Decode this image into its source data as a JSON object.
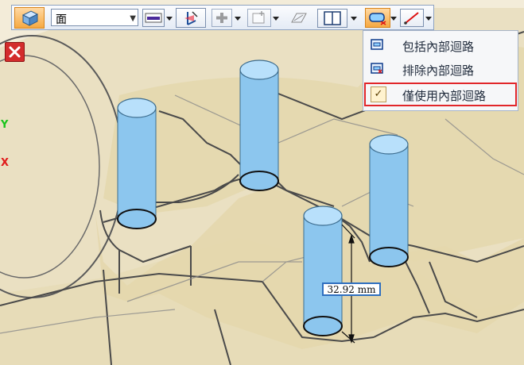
{
  "toolbar": {
    "selection_mode": "面",
    "buttons": [
      {
        "icon": "cube-select-icon",
        "state": "active"
      },
      {
        "icon": "color-bar-icon"
      },
      {
        "icon": "face-normal-icon"
      },
      {
        "icon": "plus-icon"
      },
      {
        "icon": "face-add-icon"
      },
      {
        "icon": "plane-icon"
      },
      {
        "icon": "panel-split-icon"
      },
      {
        "icon": "loop-filter-icon",
        "state": "active"
      },
      {
        "icon": "line-select-icon"
      }
    ]
  },
  "loop_menu": {
    "items": [
      {
        "label": "包括內部迴路",
        "icon": "include-loops-icon",
        "checked": false
      },
      {
        "label": "排除內部迴路",
        "icon": "exclude-loops-icon",
        "checked": false
      },
      {
        "label": "僅使用內部迴路",
        "icon": "check-icon",
        "checked": true,
        "highlighted": true
      }
    ]
  },
  "axes": {
    "y_label": "Y",
    "x_label": "X",
    "y_color": "#19c41b",
    "x_color": "#e01b1b"
  },
  "dimension": {
    "value": "32.92 mm"
  },
  "colors": {
    "cylinder": "#8cc6ee",
    "part": "#e8dcb4",
    "edge": "#4a4a4a",
    "highlight": "#e1262a"
  }
}
